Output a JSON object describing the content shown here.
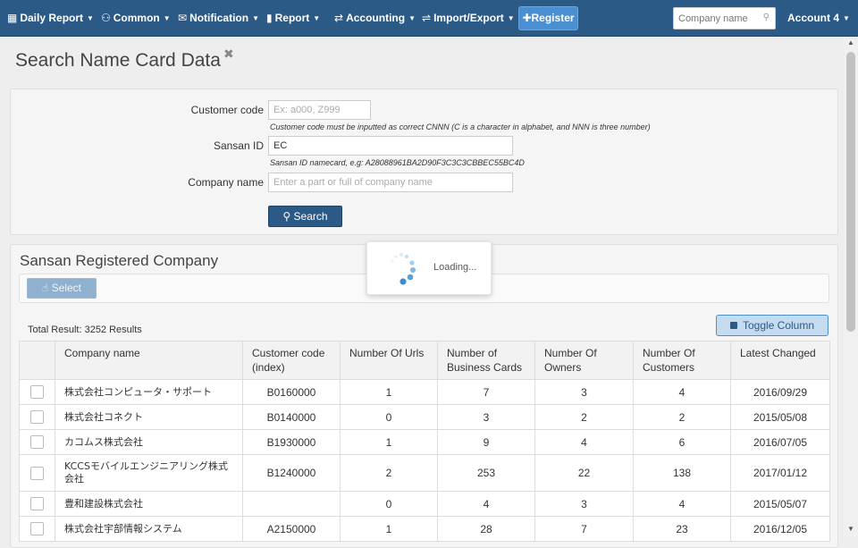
{
  "nav": {
    "items": [
      {
        "icon": "calendar-icon",
        "glyph": "▦",
        "label": "Daily Report"
      },
      {
        "icon": "users-icon",
        "glyph": "⚇",
        "label": "Common"
      },
      {
        "icon": "envelope-icon",
        "glyph": "✉",
        "label": "Notification"
      },
      {
        "icon": "bar-chart-icon",
        "glyph": "▮",
        "label": "Report"
      },
      {
        "icon": "refresh-icon",
        "glyph": "⇄",
        "label": "Accounting"
      },
      {
        "icon": "exchange-icon",
        "glyph": "⇌",
        "label": "Import/Export"
      }
    ],
    "register_label": "Register",
    "search_placeholder": "Company name",
    "account_label": "Account 4"
  },
  "page": {
    "title": "Search Name Card Data"
  },
  "form": {
    "customer_code_label": "Customer code",
    "customer_code_placeholder": "Ex: a000, Z999",
    "customer_code_help": "Customer code must be inputted as correct CNNN (C is a character in alphabet, and NNN is three number)",
    "sansan_id_label": "Sansan ID",
    "sansan_id_value": "EC",
    "sansan_id_help": "Sansan ID namecard, e.g: A28088961BA2D90F3C3C3CBBEC55BC4D",
    "company_name_label": "Company name",
    "company_name_placeholder": "Enter a part or full of company name",
    "search_label": "Search"
  },
  "results": {
    "title": "Sansan Registered Company",
    "select_label": "Select",
    "total_text": "Total Result: 3252 Results",
    "toggle_label": "Toggle Column",
    "loading_text": "Loading...",
    "columns": [
      "",
      "Company name",
      "Customer code (index)",
      "Number Of Urls",
      "Number of Business Cards",
      "Number Of Owners",
      "Number Of Customers",
      "Latest Changed"
    ],
    "rows": [
      {
        "company": "株式会社コンピュータ・サポート",
        "code": "B0160000",
        "urls": "1",
        "cards": "7",
        "owners": "3",
        "customers": "4",
        "changed": "2016/09/29"
      },
      {
        "company": "株式会社コネクト",
        "code": "B0140000",
        "urls": "0",
        "cards": "3",
        "owners": "2",
        "customers": "2",
        "changed": "2015/05/08"
      },
      {
        "company": "カコムス株式会社",
        "code": "B1930000",
        "urls": "1",
        "cards": "9",
        "owners": "4",
        "customers": "6",
        "changed": "2016/07/05"
      },
      {
        "company": "KCCSモバイルエンジニアリング株式会社",
        "code": "B1240000",
        "urls": "2",
        "cards": "253",
        "owners": "22",
        "customers": "138",
        "changed": "2017/01/12"
      },
      {
        "company": "豊和建設株式会社",
        "code": "",
        "urls": "0",
        "cards": "4",
        "owners": "3",
        "customers": "4",
        "changed": "2015/05/07"
      },
      {
        "company": "株式会社宇部情報システム",
        "code": "A2150000",
        "urls": "1",
        "cards": "28",
        "owners": "7",
        "customers": "23",
        "changed": "2016/12/05"
      }
    ]
  },
  "colors": {
    "navbar": "#2c5a87",
    "primary_button": "#2c5a87",
    "register_button": "#4a8fd0"
  }
}
